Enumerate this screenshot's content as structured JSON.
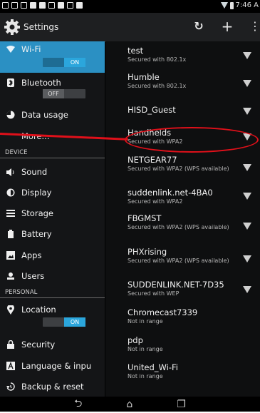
{
  "status_bar": {
    "time": "7:46 A"
  },
  "action_bar": {
    "title": "Settings"
  },
  "sidebar": {
    "wifi": {
      "label": "Wi-Fi",
      "toggle": "ON"
    },
    "bluetooth": {
      "label": "Bluetooth",
      "toggle": "OFF"
    },
    "data_usage": {
      "label": "Data usage"
    },
    "more": {
      "label": "More..."
    },
    "section_device": "DEVICE",
    "sound": {
      "label": "Sound"
    },
    "display": {
      "label": "Display"
    },
    "storage": {
      "label": "Storage"
    },
    "battery": {
      "label": "Battery"
    },
    "apps": {
      "label": "Apps"
    },
    "users": {
      "label": "Users"
    },
    "section_personal": "PERSONAL",
    "location": {
      "label": "Location",
      "toggle": "ON"
    },
    "security": {
      "label": "Security"
    },
    "language": {
      "label": "Language & inpu"
    },
    "backup": {
      "label": "Backup & reset"
    }
  },
  "networks": [
    {
      "name": "test",
      "status": "Secured with 802.1x"
    },
    {
      "name": "Humble",
      "status": "Secured with 802.1x"
    },
    {
      "name": "HISD_Guest",
      "status": ""
    },
    {
      "name": "Handhelds",
      "status": "Secured with WPA2"
    },
    {
      "name": "NETGEAR77",
      "status": "Secured with WPA2 (WPS available)"
    },
    {
      "name": "suddenlink.net-4BA0",
      "status": "Secured with WPA2"
    },
    {
      "name": "FBGMST",
      "status": "Secured with WPA2 (WPS available)"
    },
    {
      "name": "PHXrising",
      "status": "Secured with WPA2 (WPS available)"
    },
    {
      "name": "SUDDENLINK.NET-7D35",
      "status": "Secured with WEP"
    },
    {
      "name": "Chromecast7339",
      "status": "Not in range"
    },
    {
      "name": "pdp",
      "status": "Not in range"
    },
    {
      "name": "United_Wi-Fi",
      "status": "Not in range"
    }
  ]
}
